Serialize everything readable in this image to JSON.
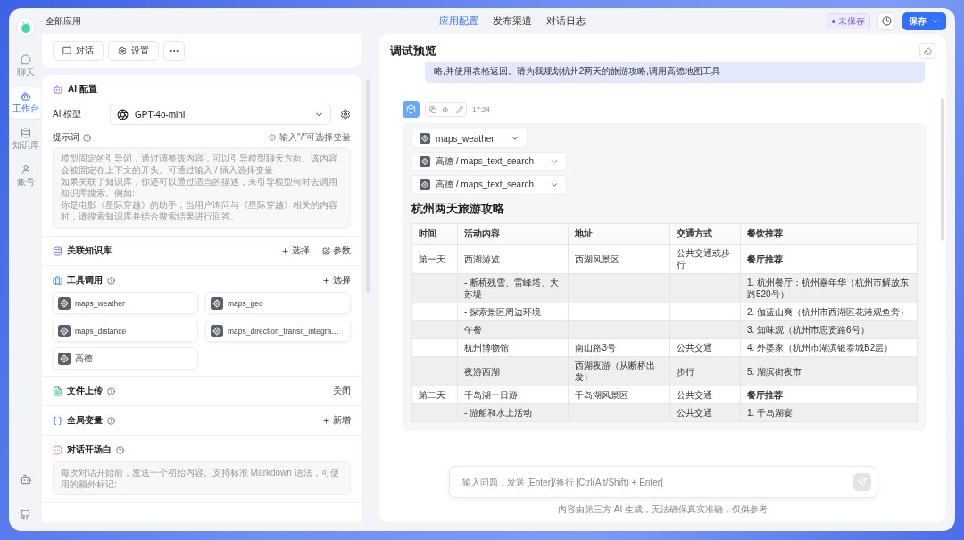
{
  "sidebar": {
    "items": [
      {
        "kind": "chat",
        "label": "聊天",
        "selected": false
      },
      {
        "kind": "workbench",
        "label": "工作台",
        "selected": true
      },
      {
        "kind": "knowledge",
        "label": "知识库",
        "selected": false
      },
      {
        "kind": "account",
        "label": "账号",
        "selected": false
      }
    ]
  },
  "header": {
    "breadcrumb": "全部应用",
    "tabs": [
      {
        "label": "应用配置",
        "selected": true
      },
      {
        "label": "发布渠道",
        "selected": false
      },
      {
        "label": "对话日志",
        "selected": false
      }
    ],
    "status": "未保存",
    "save_button": "保存"
  },
  "toolbar": {
    "buttons": [
      {
        "kind": "chat",
        "label": "对话"
      },
      {
        "kind": "settings",
        "label": "设置"
      }
    ]
  },
  "ai_config": {
    "title": "AI 配置",
    "model_label": "AI 模型",
    "model": "GPT-4o-mini",
    "prompt_label": "提示词",
    "prompt_hint": "输入\"/\"可选择变量",
    "prompt_placeholder_lines": [
      "模型固定的引导词，通过调整该内容，可以引导模型聊天方向。该内容会被固定在上下文的开头。可通过输入 / 插入选择变量",
      "如果关联了知识库，你还可以通过适当的描述，来引导模型何时去调用知识库搜索。例如:",
      "你是电影《星际穿越》的助手，当用户询问与《星际穿越》相关的内容时，请搜索知识库并结合搜索结果进行回答。"
    ]
  },
  "sections": [
    {
      "kind": "knowledge",
      "title": "关联知识库",
      "help": false,
      "actions": [
        {
          "kind": "plus",
          "label": "选择"
        },
        {
          "kind": "edit",
          "label": "参数"
        }
      ]
    },
    {
      "kind": "tools",
      "title": "工具调用",
      "help": true,
      "actions": [
        {
          "kind": "plus",
          "label": "选择"
        }
      ],
      "tools": [
        "maps_weather",
        "maps_geo",
        "maps_distance",
        "maps_direction_transit_integra…",
        "高德"
      ]
    },
    {
      "kind": "file",
      "title": "文件上传",
      "help": true,
      "actions": [
        {
          "kind": "text",
          "label": "关闭"
        }
      ]
    },
    {
      "kind": "variable",
      "title": "全局变量",
      "help": true,
      "actions": [
        {
          "kind": "plus",
          "label": "新增"
        }
      ]
    },
    {
      "kind": "welcome",
      "title": "对话开场白",
      "help": true,
      "placeholder": "每次对话开始前，发送一个初始内容。支持标准 Markdown 语法，可使用的额外标记:"
    }
  ],
  "preview": {
    "title": "调试预览",
    "user_message": "略,并使用表格返回。请为我规划杭州2两天的旅游攻略,调用高德地图工具",
    "time": "17:24",
    "tool_calls": [
      "maps_weather",
      "高德 / maps_text_search",
      "高德 / maps_text_search"
    ],
    "heading": "杭州两天旅游攻略",
    "table": {
      "columns": [
        "时间",
        "活动内容",
        "地址",
        "交通方式",
        "餐饮推荐"
      ],
      "rows": [
        {
          "cells": [
            "第一天",
            "西湖游览",
            "西湖风景区",
            "公共交通或步行",
            "餐厅推荐"
          ],
          "food_bold": true
        },
        {
          "cells": [
            "",
            "- 断桥残雪、雷峰塔、大苏堤",
            "",
            "",
            "1. 杭州餐厅：杭州嘉年华（杭州市解放东路520号）"
          ],
          "food_bold": false
        },
        {
          "cells": [
            "",
            "- 探索景区周边环境",
            "",
            "",
            "2. 伽蓝山爽（杭州市西湖区花港观鱼旁）"
          ],
          "food_bold": false
        },
        {
          "cells": [
            "",
            "午餐",
            "",
            "",
            "3. 知味观（杭州市思贤路6号）"
          ],
          "food_bold": false
        },
        {
          "cells": [
            "",
            "杭州博物馆",
            "南山路3号",
            "公共交通",
            "4. 外婆家（杭州市湖滨银泰城B2层）"
          ],
          "food_bold": false
        },
        {
          "cells": [
            "",
            "夜游西湖",
            "西湖夜游（从断桥出发）",
            "步行",
            "5. 湖滨街夜市"
          ],
          "food_bold": false
        },
        {
          "cells": [
            "第二天",
            "千岛湖一日游",
            "千岛湖风景区",
            "公共交通",
            "餐厅推荐"
          ],
          "food_bold": true
        },
        {
          "cells": [
            "",
            "- 游船和水上活动",
            "",
            "公共交通",
            "1. 千岛湖宴"
          ],
          "food_bold": false
        }
      ]
    },
    "input_placeholder": "输入问题，发送 [Enter]/换行 [Ctrl(Alt/Shift) + Enter]",
    "disclaimer": "内容由第三方 AI 生成，无法确保真实准确，仅供参考"
  }
}
